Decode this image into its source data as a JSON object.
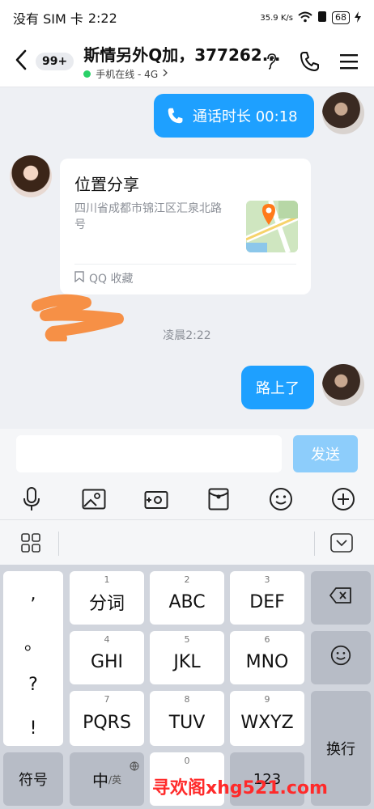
{
  "status": {
    "carrier": "没有 SIM 卡",
    "time": "2:22",
    "net_speed": "35.9 K/s",
    "battery": "68"
  },
  "header": {
    "unread_badge": "99+",
    "title": "斯情另外Q加，377262...",
    "presence": "手机在线 - 4G"
  },
  "messages": {
    "call": {
      "label": "通话时长 00:18"
    },
    "location": {
      "title": "位置分享",
      "address": "四川省成都市锦江区汇泉北路",
      "address_suffix": "号",
      "source": "QQ 收藏"
    },
    "timestamp": "凌晨2:22",
    "text": {
      "label": "路上了"
    }
  },
  "composer": {
    "placeholder": "",
    "send_label": "发送"
  },
  "keyboard": {
    "punct": [
      ",",
      "。",
      "?",
      "!"
    ],
    "keys": [
      {
        "num": "1",
        "label": "分词"
      },
      {
        "num": "2",
        "label": "ABC"
      },
      {
        "num": "3",
        "label": "DEF"
      },
      {
        "num": "4",
        "label": "GHI"
      },
      {
        "num": "5",
        "label": "JKL"
      },
      {
        "num": "6",
        "label": "MNO"
      },
      {
        "num": "7",
        "label": "PQRS"
      },
      {
        "num": "8",
        "label": "TUV"
      },
      {
        "num": "9",
        "label": "WXYZ"
      }
    ],
    "newline_label": "换行",
    "symbols_label": "符号",
    "lang_label": "中",
    "lang_alt_label": "/英",
    "zero_num": "0",
    "num_label": "123"
  },
  "watermark": "寻欢阁xhg521.com",
  "colors": {
    "accent": "#1ea0ff",
    "send_disabled": "#8dcdfb",
    "online": "#2ad168",
    "watermark": "#ff2a2a"
  }
}
